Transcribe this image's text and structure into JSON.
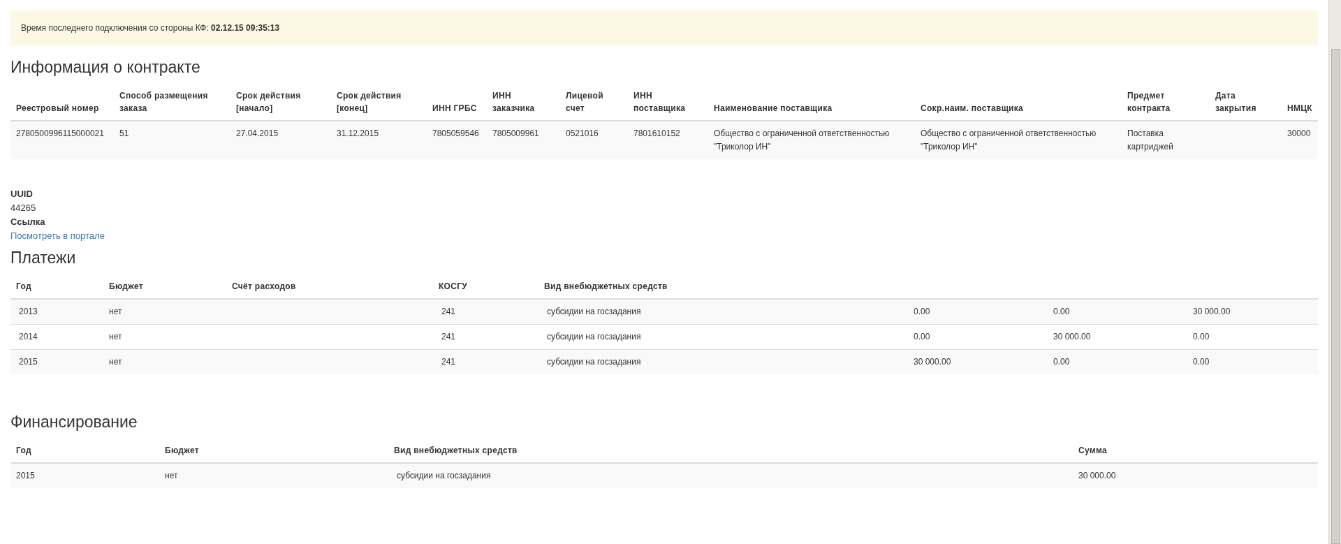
{
  "alert": {
    "label": "Время последнего подключения со стороны КФ:",
    "value": "02.12.15 09:35:13"
  },
  "contract": {
    "title": "Информация о контракте",
    "columns": [
      "Реестровый номер",
      "Способ размещения заказа",
      "Срок действия [начало]",
      "Срок действия [конец]",
      "ИНН ГРБС",
      "ИНН заказчика",
      "Лицевой счет",
      "ИНН поставщика",
      "Наименование поставщика",
      "Сокр.наим. поставщика",
      "Предмет контракта",
      "Дата закрытия",
      "НМЦК"
    ],
    "rows": [
      [
        "2780500996115000021",
        "51",
        "27.04.2015",
        "31.12.2015",
        "7805059546",
        "7805009961",
        "0521016",
        "7801610152",
        "Общество с ограниченной ответственностью \"Триколор ИН\"",
        "Общество с ограниченной ответственностью \"Триколор ИН\"",
        "Поставка картриджей",
        "",
        "30000"
      ]
    ]
  },
  "details": [
    {
      "label": "UUID",
      "value": "44265",
      "kind": "text"
    },
    {
      "label": "Ссылка",
      "value": "Посмотреть в портале",
      "kind": "link"
    }
  ],
  "payments": {
    "title": "Платежи",
    "columns": [
      "Год",
      "Бюджет",
      "Счёт расходов",
      "КОСГУ",
      "Вид внебюджетных средств",
      "",
      "",
      ""
    ],
    "rows": [
      [
        "2013",
        "нет",
        "",
        "241",
        "субсидии на госзадания",
        "0.00",
        "0.00",
        "30 000.00"
      ],
      [
        "2014",
        "нет",
        "",
        "241",
        "субсидии на госзадания",
        "0.00",
        "30 000.00",
        "0.00"
      ],
      [
        "2015",
        "нет",
        "",
        "241",
        "субсидии на госзадания",
        "30 000.00",
        "0.00",
        "0.00"
      ]
    ]
  },
  "financing": {
    "title": "Финансирование",
    "columns": [
      "Год",
      "Бюджет",
      "Вид внебюджетных средств",
      "Сумма"
    ],
    "rows": [
      [
        "2015",
        "нет",
        "субсидии на госзадания",
        "30 000.00"
      ]
    ]
  }
}
